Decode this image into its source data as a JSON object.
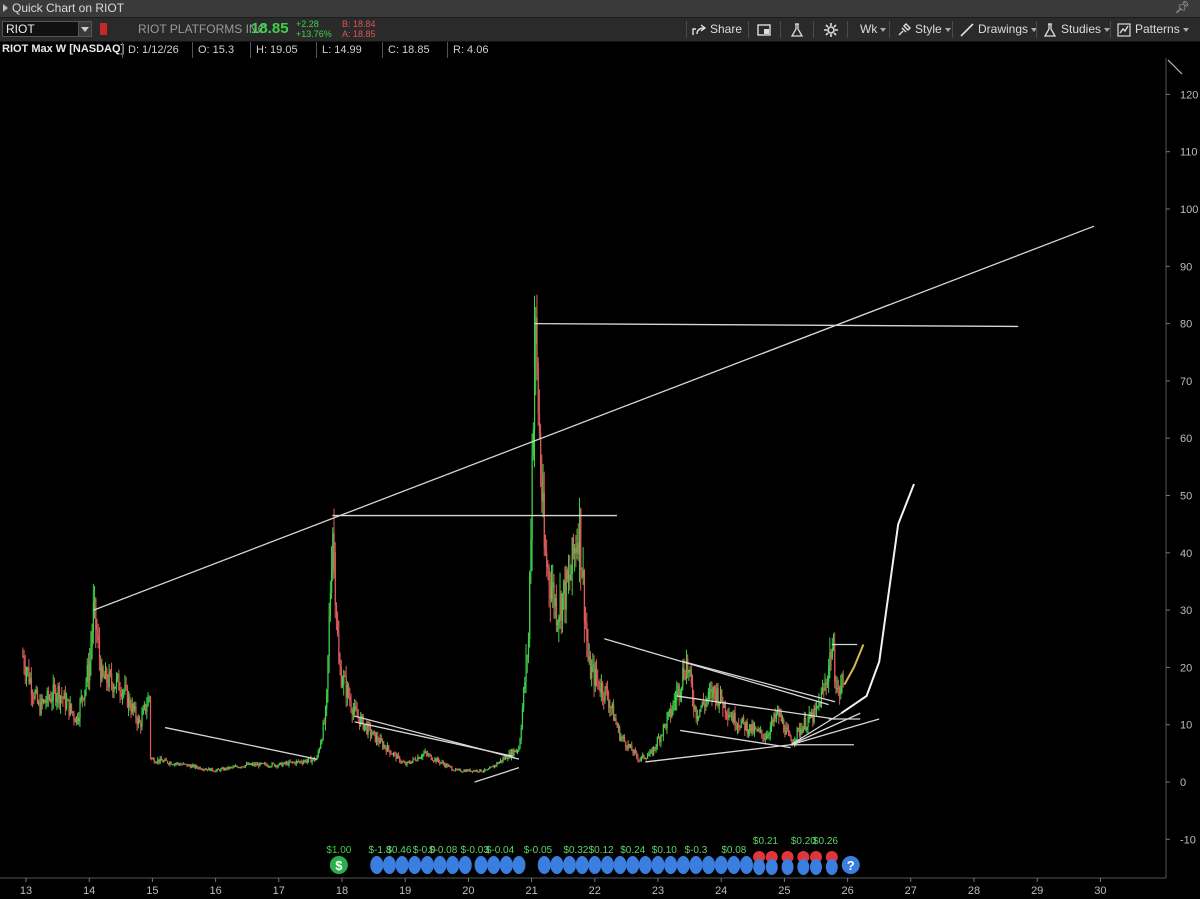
{
  "window": {
    "title": "Quick Chart on RIOT",
    "pin_icon": "pushpin-icon"
  },
  "toolbar": {
    "symbol": "RIOT",
    "company": "RIOT PLATFORMS INC",
    "last": "18.85",
    "change": "+2.28",
    "change_pct": "+13.76%",
    "bid": "B: 18.84",
    "ask": "A: 18.85",
    "share_label": "Share",
    "timeframe_label": "Wk",
    "style_label": "Style",
    "drawings_label": "Drawings",
    "studies_label": "Studies",
    "patterns_label": "Patterns"
  },
  "infobar": {
    "title": "RIOT Max W [NASDAQ]",
    "date": "D: 1/12/26",
    "open": "O: 15.3",
    "high": "H: 19.05",
    "low": "L: 14.99",
    "close": "C: 18.85",
    "range": "R: 4.06"
  },
  "colors": {
    "up": "#3fd14a",
    "down": "#e05c5c",
    "drawing": "#d7d7d7",
    "accent_yellow": "#d9b84a",
    "event_blue": "#3a7ee0",
    "event_red": "#e0353b",
    "dividend_green": "#29b04a"
  },
  "chart_data": {
    "type": "candlestick",
    "y_axis": {
      "min": -10,
      "max": 120,
      "ticks": [
        -10,
        0,
        10,
        20,
        30,
        40,
        50,
        60,
        70,
        80,
        90,
        100,
        110,
        120
      ]
    },
    "x_axis": {
      "ticks": [
        "13",
        "14",
        "15",
        "16",
        "17",
        "18",
        "19",
        "20",
        "21",
        "22",
        "23",
        "24",
        "25",
        "26",
        "27",
        "28",
        "29",
        "30"
      ]
    },
    "price_path": [
      [
        12.95,
        22
      ],
      [
        13.2,
        13
      ],
      [
        13.5,
        16
      ],
      [
        13.8,
        11
      ],
      [
        14.0,
        20
      ],
      [
        14.07,
        30
      ],
      [
        14.2,
        18
      ],
      [
        14.5,
        17
      ],
      [
        14.8,
        10
      ],
      [
        14.95,
        15
      ],
      [
        14.97,
        4
      ],
      [
        15.5,
        3
      ],
      [
        16.0,
        2
      ],
      [
        16.5,
        3
      ],
      [
        17.0,
        3
      ],
      [
        17.6,
        4
      ],
      [
        17.75,
        12
      ],
      [
        17.85,
        46
      ],
      [
        17.95,
        20
      ],
      [
        18.2,
        12
      ],
      [
        18.5,
        8
      ],
      [
        19.0,
        3
      ],
      [
        19.3,
        5
      ],
      [
        19.8,
        2
      ],
      [
        20.3,
        2
      ],
      [
        20.8,
        6
      ],
      [
        20.95,
        25
      ],
      [
        21.05,
        80
      ],
      [
        21.2,
        40
      ],
      [
        21.4,
        30
      ],
      [
        21.6,
        35
      ],
      [
        21.75,
        46
      ],
      [
        21.9,
        20
      ],
      [
        22.2,
        15
      ],
      [
        22.4,
        8
      ],
      [
        22.7,
        4
      ],
      [
        22.9,
        5
      ],
      [
        23.2,
        12
      ],
      [
        23.45,
        21
      ],
      [
        23.6,
        12
      ],
      [
        23.9,
        16
      ],
      [
        24.2,
        11
      ],
      [
        24.5,
        9
      ],
      [
        24.7,
        8
      ],
      [
        24.9,
        12
      ],
      [
        25.1,
        7
      ],
      [
        25.3,
        10
      ],
      [
        25.5,
        12
      ],
      [
        25.65,
        17
      ],
      [
        25.75,
        24
      ],
      [
        25.85,
        15
      ],
      [
        25.95,
        18.85
      ]
    ],
    "drawings": {
      "lines": [
        {
          "from": [
            14.07,
            30
          ],
          "to": [
            29.9,
            97
          ]
        },
        {
          "from": [
            21.05,
            80
          ],
          "to": [
            28.7,
            79.5
          ]
        },
        {
          "from": [
            17.85,
            46.5
          ],
          "to": [
            22.35,
            46.5
          ]
        },
        {
          "from": [
            15.2,
            9.5
          ],
          "to": [
            17.6,
            4
          ]
        },
        {
          "from": [
            18.2,
            11.5
          ],
          "to": [
            20.8,
            4
          ]
        },
        {
          "from": [
            18.2,
            10.5
          ],
          "to": [
            20.7,
            4.5
          ]
        },
        {
          "from": [
            20.1,
            0
          ],
          "to": [
            20.8,
            2.5
          ]
        },
        {
          "from": [
            22.15,
            25
          ],
          "to": [
            25.7,
            13.5
          ]
        },
        {
          "from": [
            23.4,
            21
          ],
          "to": [
            25.8,
            14
          ]
        },
        {
          "from": [
            23.3,
            15
          ],
          "to": [
            25.8,
            11
          ]
        },
        {
          "from": [
            23.35,
            9
          ],
          "to": [
            25.1,
            6
          ]
        },
        {
          "from": [
            22.8,
            3.5
          ],
          "to": [
            25.1,
            6.5
          ]
        },
        {
          "from": [
            25.1,
            6.5
          ],
          "to": [
            26.1,
            6.5
          ]
        },
        {
          "from": [
            25.1,
            6.5
          ],
          "to": [
            26.5,
            11
          ]
        },
        {
          "from": [
            25.1,
            6.5
          ],
          "to": [
            26.2,
            12
          ]
        },
        {
          "from": [
            25.1,
            6.5
          ],
          "to": [
            25.9,
            12
          ]
        },
        {
          "from": [
            25.75,
            24
          ],
          "to": [
            26.15,
            24
          ]
        },
        {
          "from": [
            25.7,
            11
          ],
          "to": [
            26.2,
            11
          ]
        }
      ],
      "curves": [
        {
          "points": [
            [
              25.9,
              12
            ],
            [
              26.3,
              15
            ],
            [
              26.5,
              21
            ],
            [
              26.8,
              45
            ],
            [
              27.05,
              52
            ]
          ],
          "color": "white"
        },
        {
          "points": [
            [
              25.95,
              17
            ],
            [
              26.1,
              20
            ],
            [
              26.25,
              24
            ]
          ],
          "color": "yellow"
        }
      ]
    },
    "events": {
      "dividend": {
        "x": 17.95,
        "label": "$1.00"
      },
      "earnings": [
        {
          "x": 18.6,
          "label": "$-1.8"
        },
        {
          "x": 18.9,
          "label": "$0.46"
        },
        {
          "x": 19.3,
          "label": "$-0.0"
        },
        {
          "x": 19.6,
          "label": "$-0.08"
        },
        {
          "x": 20.1,
          "label": "$-0.03"
        },
        {
          "x": 20.5,
          "label": "$-0.04"
        },
        {
          "x": 21.1,
          "label": "$-0.05"
        },
        {
          "x": 21.7,
          "label": "$0.32"
        },
        {
          "x": 22.1,
          "label": "$0.12"
        },
        {
          "x": 22.6,
          "label": "$0.24"
        },
        {
          "x": 23.1,
          "label": "$0.10"
        },
        {
          "x": 23.6,
          "label": "$-0.3"
        },
        {
          "x": 24.2,
          "label": "$0.08"
        },
        {
          "x": 24.7,
          "label": "$0.21"
        },
        {
          "x": 25.3,
          "label": "$0.20"
        },
        {
          "x": 25.65,
          "label": "$0.26"
        }
      ],
      "earnings_icons_blue": [
        18.55,
        18.75,
        18.95,
        19.15,
        19.35,
        19.55,
        19.75,
        19.95,
        20.2,
        20.4,
        20.6,
        20.8,
        21.2,
        21.4,
        21.6,
        21.8,
        22.0,
        22.2,
        22.4,
        22.6,
        22.8,
        23.0,
        23.2,
        23.4,
        23.6,
        23.8,
        24.0,
        24.2,
        24.4
      ],
      "earnings_icons_red": [
        24.6,
        24.8,
        25.05,
        25.3,
        25.5,
        25.75
      ],
      "help_x": 26.05
    }
  }
}
